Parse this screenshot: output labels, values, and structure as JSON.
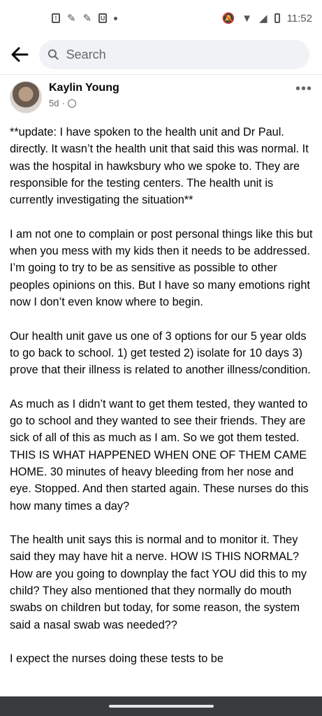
{
  "status_bar": {
    "time": "11:52",
    "left_icons": [
      "notification-icon",
      "edit-icon",
      "edit-icon",
      "app-icon",
      "dot-icon"
    ],
    "right_icons": [
      "mute-icon",
      "wifi-icon",
      "signal-icon",
      "battery-icon"
    ]
  },
  "header": {
    "search_placeholder": "Search"
  },
  "post": {
    "author": "Kaylin Young",
    "age": "5d",
    "separator": "·",
    "more_label": "•••",
    "paragraphs": [
      "**update: I have spoken to the health unit and Dr Paul. directly. It wasn’t the health unit that said this was normal. It was the hospital in hawksbury who we spoke to. They are responsible for the testing centers. The health unit is currently investigating the situation**",
      "I am not one to complain or post personal things like this but when you mess with my kids then it needs to be addressed. I’m going to try to be as sensitive as possible to other peoples opinions on this. But I have so many emotions right now I don’t even know where to begin.",
      "Our health unit gave us one of 3 options for our 5 year olds to go back to school. 1) get tested 2) isolate for 10 days 3) prove that their illness is related to another illness/condition.",
      "As much as I didn’t want to get them tested, they wanted to go to school and they wanted to see their friends. They are sick of all of this as much as I am. So we got them tested. THIS IS WHAT HAPPENED WHEN ONE OF THEM CAME HOME. 30 minutes of heavy bleeding from her nose and eye. Stopped. And then started again. These nurses do this how many times a day?",
      "The health unit says this is normal and to monitor it. They said they may have hit a nerve. HOW IS THIS NORMAL? How are you going to downplay the fact YOU did this to my child? They also mentioned that they normally do mouth swabs on children but today, for some reason, the system said a nasal swab was needed??",
      "I expect the nurses doing these tests to be"
    ]
  }
}
